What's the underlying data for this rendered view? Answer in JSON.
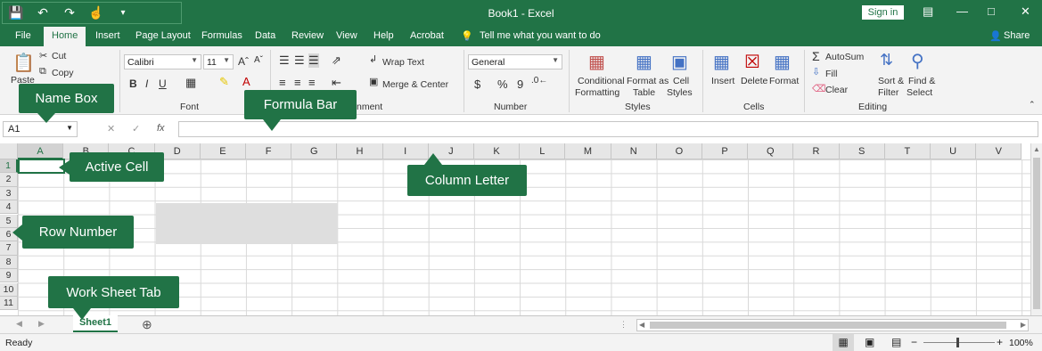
{
  "titlebar": {
    "title": "Book1  -  Excel",
    "signin_label": "Sign in",
    "qat_icons": [
      "save-icon",
      "undo-icon",
      "redo-icon",
      "touch-mode-icon",
      "customize-icon"
    ],
    "accent": "#217346"
  },
  "tabs": [
    "File",
    "Home",
    "Insert",
    "Page Layout",
    "Formulas",
    "Data",
    "Review",
    "View",
    "Help",
    "Acrobat"
  ],
  "active_tab": "Home",
  "tell_me": "Tell me what you want to do",
  "share_label": "Share",
  "ribbon": {
    "clipboard": {
      "paste": "Paste",
      "cut": "Cut",
      "copy": "Copy"
    },
    "font": {
      "name": "Calibri",
      "size": "11",
      "bold": "B",
      "italic": "I",
      "underline": "U",
      "label": "Font"
    },
    "alignment": {
      "wrap": "Wrap Text",
      "merge": "Merge & Center",
      "label": "nment"
    },
    "number": {
      "format": "General",
      "currency": "$",
      "percent": "%",
      "comma": "9",
      "label": "Number"
    },
    "styles": {
      "conditional": "Conditional",
      "conditional2": "Formatting",
      "format_as": "Format as",
      "table": "Table",
      "cell": "Cell",
      "cell_styles": "Styles",
      "label": "Styles"
    },
    "cells": {
      "insert": "Insert",
      "delete": "Delete",
      "format": "Format",
      "label": "Cells"
    },
    "editing": {
      "autosum": "AutoSum",
      "fill": "Fill",
      "clear": "Clear",
      "sort": "Sort &",
      "filter": "Filter",
      "find": "Find &",
      "select": "Select",
      "label": "Editing"
    }
  },
  "formula_bar": {
    "name_box": "A1",
    "fx": "fx",
    "cancel": "✕",
    "enter": "✓"
  },
  "columns": [
    "A",
    "B",
    "C",
    "D",
    "E",
    "F",
    "G",
    "H",
    "I",
    "J",
    "K",
    "L",
    "M",
    "N",
    "O",
    "P",
    "Q",
    "R",
    "S",
    "T",
    "U",
    "V"
  ],
  "rows": [
    "1",
    "2",
    "3",
    "4",
    "5",
    "6",
    "7",
    "8",
    "9",
    "10",
    "11"
  ],
  "sheet_tab": "Sheet1",
  "status": {
    "ready": "Ready",
    "zoom": "100%"
  },
  "callouts": {
    "name_box": "Name Box",
    "formula_bar": "Formula Bar",
    "active_cell": "Active Cell",
    "column_letter": "Column Letter",
    "row_number": "Row Number",
    "work_sheet_tab": "Work Sheet Tab"
  }
}
